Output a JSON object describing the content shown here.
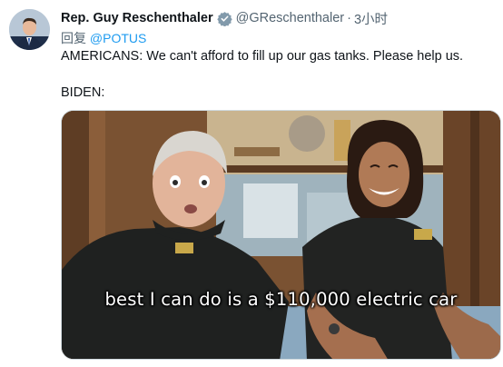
{
  "tweet": {
    "author_name": "Rep. Guy Reschenthaler",
    "handle": "@GReschenthaler",
    "separator": "·",
    "time": "3小时",
    "reply_prefix": "回复",
    "reply_to": "@POTUS",
    "text_line1": "AMERICANS: We can't afford to fill up our gas tanks. Please help us.",
    "text_line2": "BIDEN:",
    "verified_icon": "verified-badge-icon",
    "colors": {
      "link": "#1d9bf0",
      "secondary": "#536471",
      "verified": "#829aab"
    }
  },
  "media": {
    "caption": "best I can do is a $110,000 electric car"
  }
}
